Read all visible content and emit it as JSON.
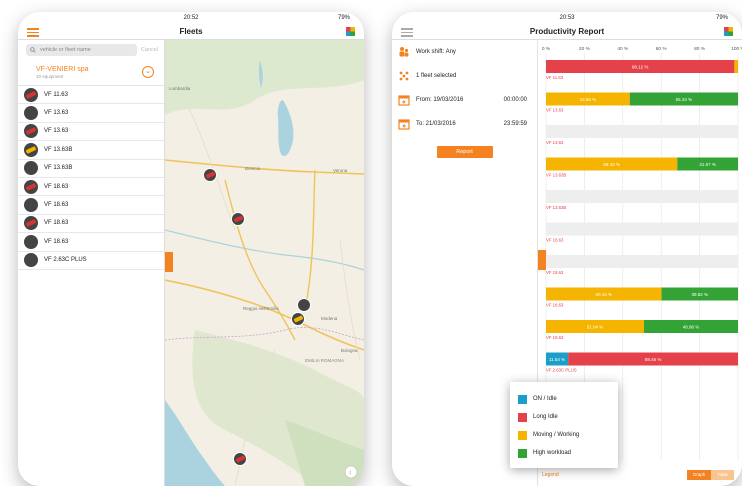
{
  "left_app": {
    "time": "20:52",
    "battery": "79%",
    "title": "Fleets",
    "search": {
      "placeholder": "vehicle or fleet name",
      "cancel": "Cancel"
    },
    "fleet": {
      "name": "VF-VENIERI spa",
      "sub": "10 equipment"
    },
    "vehicles": [
      {
        "label": "VF 11.63",
        "color": "#d63434"
      },
      {
        "label": "VF 13.63",
        "color": ""
      },
      {
        "label": "VF 13.63",
        "color": "#d63434"
      },
      {
        "label": "VF 13.63B",
        "color": "#f2b400"
      },
      {
        "label": "VF 13.63B",
        "color": ""
      },
      {
        "label": "VF 18.63",
        "color": "#d63434"
      },
      {
        "label": "VF 18.63",
        "color": ""
      },
      {
        "label": "VF 18.63",
        "color": "#d63434"
      },
      {
        "label": "VF 18.63",
        "color": ""
      },
      {
        "label": "VF 2.63C PLUS",
        "color": ""
      }
    ],
    "map_labels": [
      "Lombardia",
      "Brescia",
      "Verona",
      "Reggio nell'Emilia",
      "Modena",
      "EMILIA ROMAGNA",
      "Bologna"
    ]
  },
  "right_app": {
    "time": "20:53",
    "battery": "79%",
    "title": "Productivity Report",
    "filters": {
      "work_shift": "Work shift: Any",
      "fleet_selected": "1 fleet selected",
      "from": "From: 19/03/2016",
      "from_time": "00:00:00",
      "to": "To: 21/03/2016",
      "to_time": "23:59:59",
      "report_button": "Report"
    },
    "legend": {
      "items": [
        {
          "label": "ON / Idle",
          "color": "#1b9fc9"
        },
        {
          "label": "Long Idle",
          "color": "#e5414a"
        },
        {
          "label": "Moving / Working",
          "color": "#f5b400"
        },
        {
          "label": "High workload",
          "color": "#34a336"
        }
      ],
      "link": "Legend"
    },
    "bottom_buttons": [
      "Graph",
      "Table"
    ]
  },
  "chart_data": {
    "type": "bar",
    "orientation": "horizontal-stacked",
    "axis_ticks": [
      "0 %",
      "20 %",
      "40 %",
      "60 %",
      "80 %",
      "100 %"
    ],
    "xlim": [
      0,
      100
    ],
    "categories": [
      "VF 11.63",
      "VF 13.63",
      "VF 13.63",
      "VF 13.63B",
      "VF 13.63B",
      "VF 18.63",
      "VF 18.63",
      "VF 18.63",
      "VF 18.63",
      "VF 2.63C PLUS"
    ],
    "series": [
      {
        "name": "ON / Idle",
        "color": "#1b9fc9",
        "values": [
          0,
          0,
          0,
          0,
          0,
          0,
          0,
          0,
          0,
          11.54
        ],
        "labels": [
          "",
          "",
          "",
          "",
          "",
          "",
          "",
          "",
          "",
          "11.54 %"
        ]
      },
      {
        "name": "Long Idle",
        "color": "#e5414a",
        "values": [
          98.12,
          0,
          0,
          0,
          0,
          0,
          0,
          0,
          0,
          88.46
        ],
        "labels": [
          "98.12 %",
          "",
          "",
          "",
          "",
          "",
          "",
          "",
          "",
          "88.46 %"
        ]
      },
      {
        "name": "Moving / Working",
        "color": "#f5b400",
        "values": [
          1.88,
          43.66,
          0,
          68.43,
          0,
          0,
          0,
          60.18,
          51.04,
          0
        ],
        "labels": [
          "",
          "43.66 %",
          "",
          "68.43 %",
          "",
          "",
          "",
          "60.18 %",
          "51.04 %",
          ""
        ]
      },
      {
        "name": "High workload",
        "color": "#34a336",
        "values": [
          0,
          56.34,
          0,
          31.57,
          0,
          0,
          0,
          39.82,
          48.96,
          0
        ],
        "labels": [
          "",
          "56.34 %",
          "",
          "31.57 %",
          "",
          "",
          "",
          "39.82 %",
          "48.96 %",
          ""
        ]
      }
    ]
  }
}
